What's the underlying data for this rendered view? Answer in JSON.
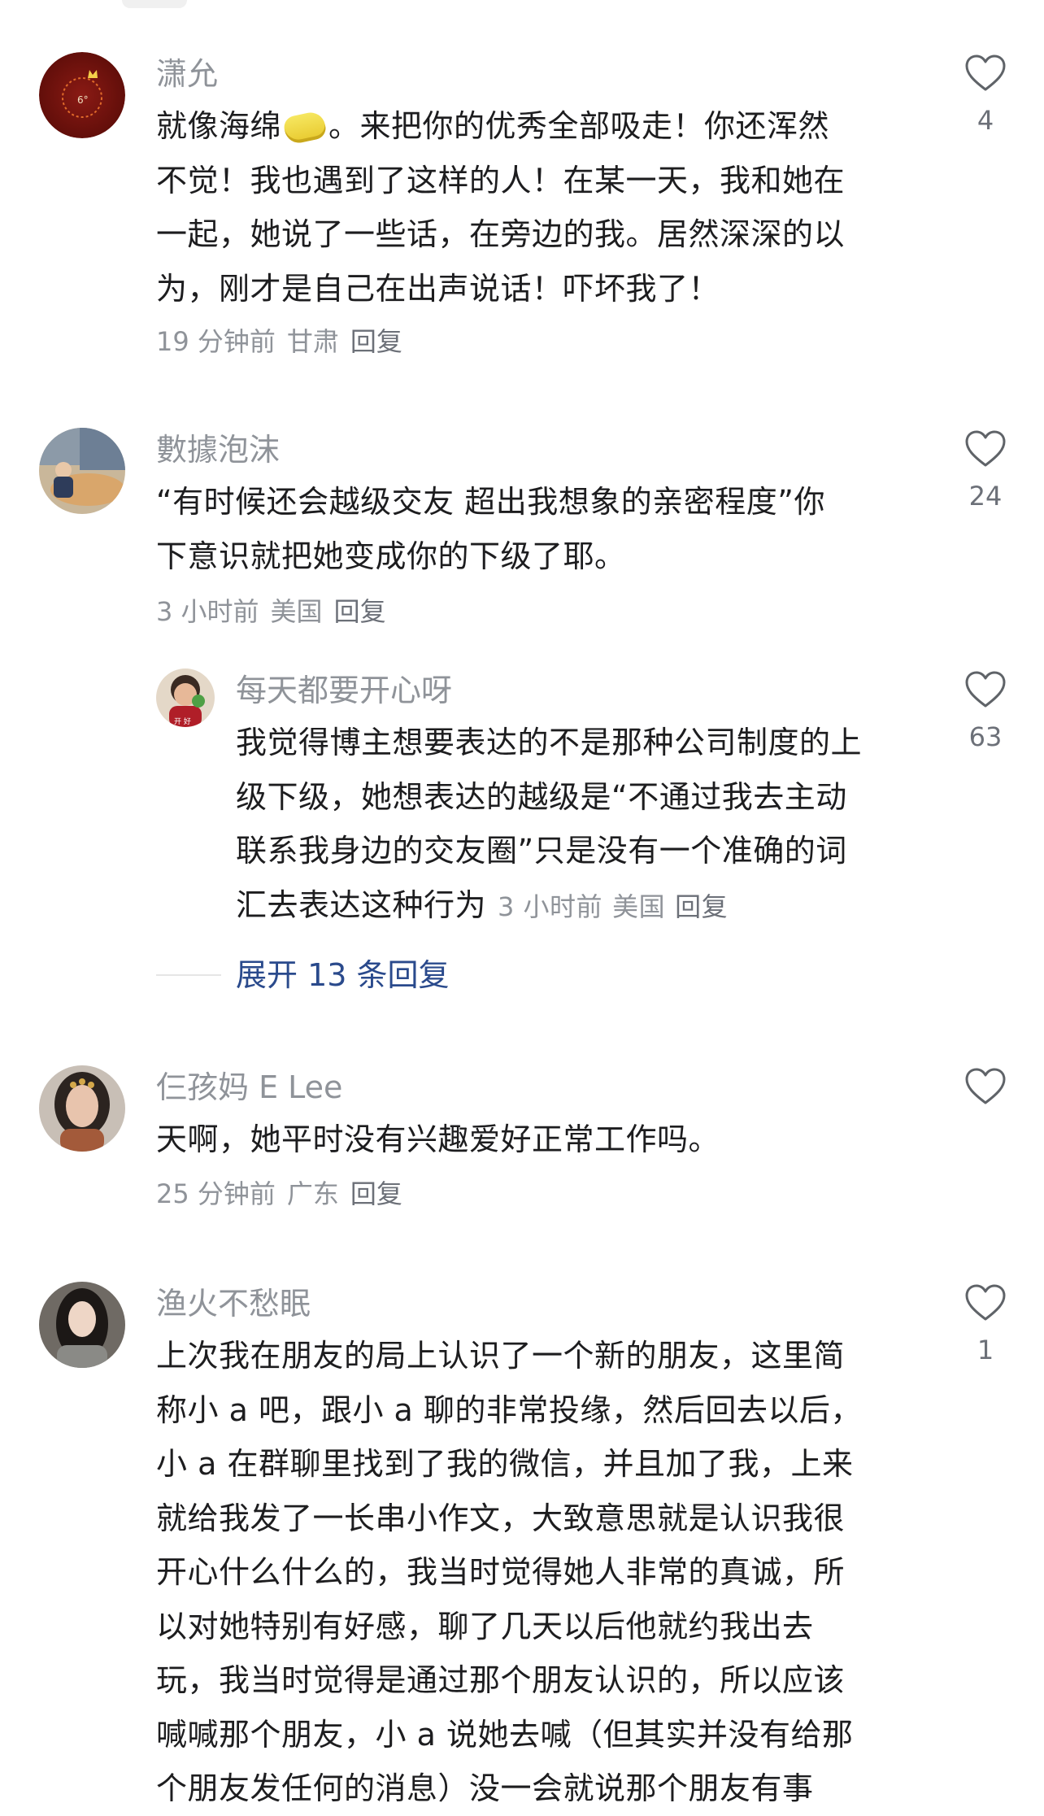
{
  "comments": [
    {
      "username": "潇允",
      "text_lines": [
        [
          "就像海绵",
          "。来把你的优秀全部吸走！你还浑然"
        ],
        "不觉！我也遇到了这样的人！在某一天，我和她在",
        "一起，她说了一些话，在旁边的我。居然深深的以",
        "为，刚才是自己在出声说话！吓坏我了！"
      ],
      "time": "19 分钟前",
      "location": "甘肃",
      "reply_label": "回复",
      "likes": "4"
    },
    {
      "username": "數據泡沫",
      "text_lines": [
        "“有时候还会越级交友 超出我想象的亲密程度”你",
        "下意识就把她变成你的下级了耶。"
      ],
      "time": "3 小时前",
      "location": "美国",
      "reply_label": "回复",
      "likes": "24"
    },
    {
      "username": "每天都要开心呀",
      "text_lines": [
        "我觉得博主想要表达的不是那种公司制度的上",
        "级下级，她想表达的越级是“不通过我去主动",
        "联系我身边的交友圈”只是没有一个准确的词",
        "汇去表达这种行为"
      ],
      "time": "3 小时前",
      "location": "美国",
      "reply_label": "回复",
      "likes": "63"
    },
    {
      "username": "仨孩妈 E Lee",
      "text_lines": [
        "天啊，她平时没有兴趣爱好正常工作吗。"
      ],
      "time": "25 分钟前",
      "location": "广东",
      "reply_label": "回复",
      "likes": ""
    },
    {
      "username": "渔火不愁眠",
      "text_lines": [
        "上次我在朋友的局上认识了一个新的朋友，这里简",
        "称小 a 吧，跟小 a 聊的非常投缘，然后回去以后，",
        "小 a 在群聊里找到了我的微信，并且加了我，上来",
        "就给我发了一长串小作文，大致意思就是认识我很",
        "开心什么什么的，我当时觉得她人非常的真诚，所",
        "以对她特别有好感，聊了几天以后他就约我出去",
        "玩，我当时觉得是通过那个朋友认识的，所以应该",
        "喊喊那个朋友，小 a 说她去喊（但其实并没有给那",
        "个朋友发任何的消息）没一会就说那个朋友有事"
      ],
      "likes": "1"
    }
  ],
  "expand_replies_label": "展开 13 条回复",
  "icons": {
    "like": "heart-outline-icon",
    "sponge": "sponge-emoji-icon"
  },
  "colors": {
    "username": "#8f9399",
    "body_text": "#1d1d1f",
    "expand_link": "#2a4a8c"
  }
}
